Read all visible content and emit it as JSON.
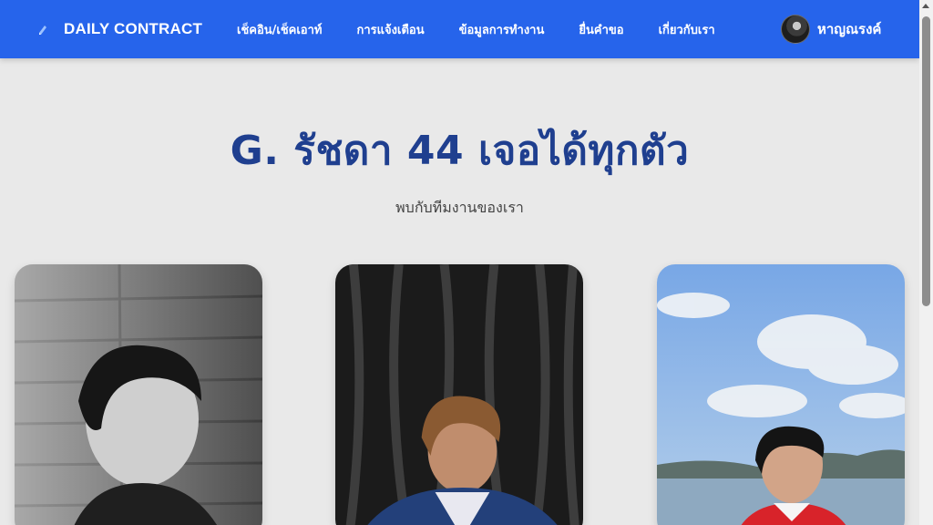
{
  "navbar": {
    "brand": "DAILY CONTRACT",
    "links": [
      "เช็คอิน/เช็คเอาท์",
      "การแจ้งเตือน",
      "ข้อมูลการทำงาน",
      "ยื่นคำขอ",
      "เกี่ยวกับเรา"
    ],
    "user_name": "หาญณรงค์",
    "color": "#2664eb"
  },
  "hero": {
    "title": "G. รัชดา 44 เจอได้ทุกตัว",
    "subtitle": "พบกับทีมงานของเรา",
    "title_color": "#1f3f8f"
  },
  "team_photos": [
    "team-member-1-photo",
    "team-member-2-photo",
    "team-member-3-photo"
  ]
}
